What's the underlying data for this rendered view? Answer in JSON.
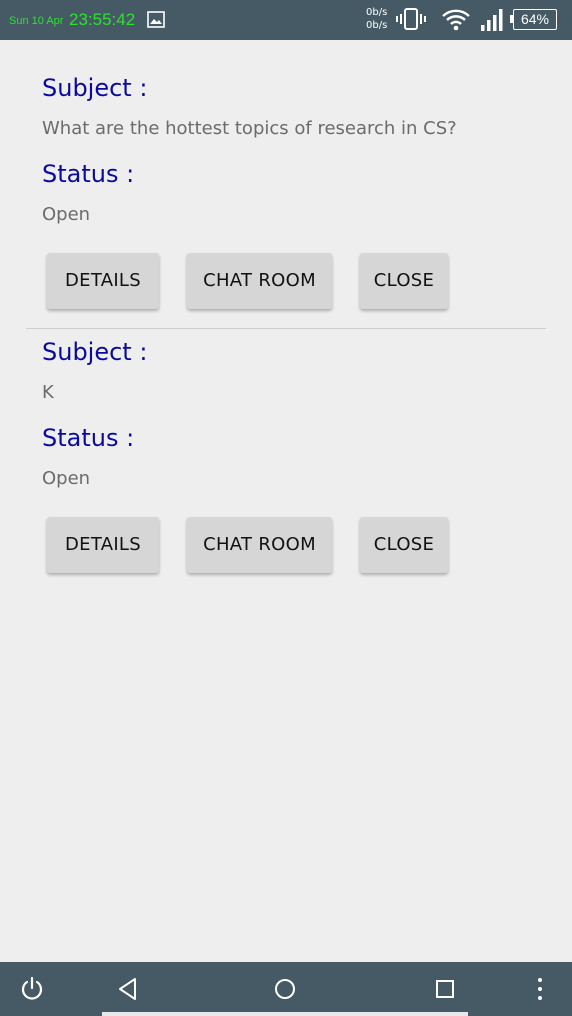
{
  "status_bar": {
    "date": "Sun 10 Apr",
    "time": "23:55:42",
    "net_up": "0b/s",
    "net_down": "0b/s",
    "battery": "64%",
    "icons": [
      "gallery-icon",
      "vibrate-icon",
      "wifi-icon",
      "signal-icon",
      "battery-icon"
    ]
  },
  "tickets": [
    {
      "subject_label": "Subject :",
      "subject": "What are the hottest topics of research in CS?",
      "status_label": "Status :",
      "status": "Open",
      "buttons": {
        "details": "DETAILS",
        "chat_room": "CHAT ROOM",
        "close": "CLOSE"
      }
    },
    {
      "subject_label": "Subject :",
      "subject": "K",
      "status_label": "Status :",
      "status": "Open",
      "buttons": {
        "details": "DETAILS",
        "chat_room": "CHAT ROOM",
        "close": "CLOSE"
      }
    }
  ],
  "nav_bar": {
    "icons": [
      "power-icon",
      "back-icon",
      "home-icon",
      "recents-icon",
      "more-icon"
    ]
  },
  "colors": {
    "bars": "#455a64",
    "background": "#eeeeee",
    "label": "#0a0a9e",
    "value": "#6b6b6b",
    "button": "#d6d6d6",
    "clock": "#2fe02f"
  }
}
